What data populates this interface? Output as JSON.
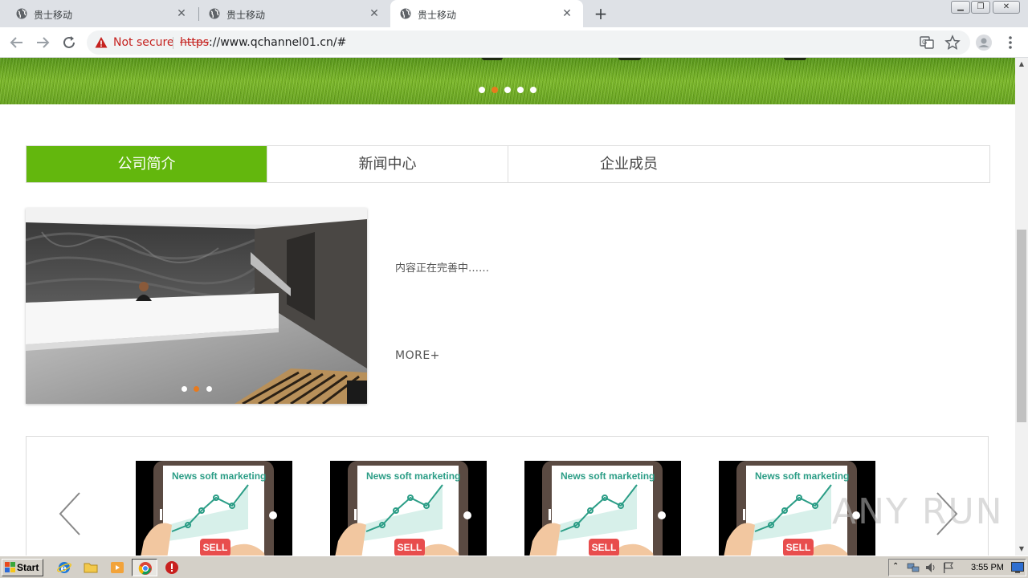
{
  "browser": {
    "tabs": [
      {
        "title": "贵士移动",
        "active": false
      },
      {
        "title": "贵士移动",
        "active": false
      },
      {
        "title": "贵士移动",
        "active": true
      }
    ],
    "new_tab_label": "+",
    "security_label": "Not secure",
    "url_scheme": "https",
    "url_rest": "://www.qchannel01.cn/#",
    "window_controls": [
      "minimize",
      "restore",
      "close"
    ],
    "icons": [
      "back-icon",
      "forward-icon",
      "reload-icon",
      "translate-icon",
      "bookmark-star-icon",
      "profile-icon"
    ]
  },
  "page": {
    "banner": {
      "slides": 5,
      "active_slide": 2
    },
    "tabs": [
      {
        "label": "公司简介",
        "active": true
      },
      {
        "label": "新闻中心",
        "active": false
      },
      {
        "label": "企业成员",
        "active": false
      }
    ],
    "intro": {
      "text": "内容正在完善中……",
      "more": "MORE+",
      "photo_slides": 3,
      "photo_active_slide": 2
    },
    "products": [
      {
        "title": "News soft marketing",
        "badge": "SELL"
      },
      {
        "title": "News soft marketing",
        "badge": "SELL"
      },
      {
        "title": "News soft marketing",
        "badge": "SELL"
      },
      {
        "title": "News soft marketing",
        "badge": "SELL"
      }
    ],
    "watermark": "ANY RUN"
  },
  "taskbar": {
    "start_label": "Start",
    "clock": "3:55 PM"
  },
  "colors": {
    "accent_green": "#63b70d",
    "dot_active": "#e87a1d",
    "not_secure": "#c5221f"
  }
}
